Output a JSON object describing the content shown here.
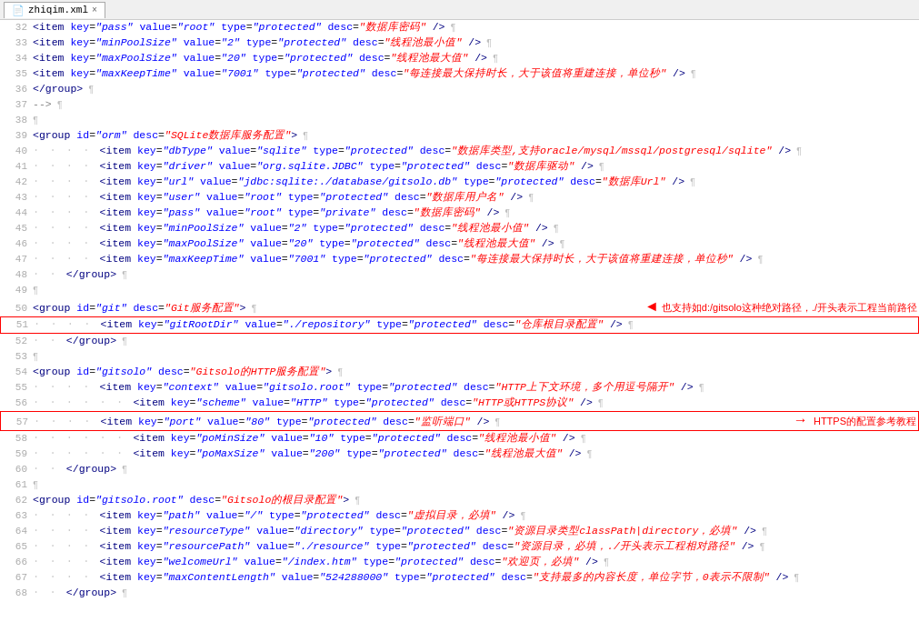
{
  "window": {
    "title": "zhiqim.xml",
    "tab_label": "zhiqim.xml",
    "close_icon": "×"
  },
  "lines": [
    {
      "num": 32,
      "content": "<item key=\"pass\" value=\"root\" type=\"protected\" desc=\"数据库密码\" />",
      "highlight": false,
      "annotation": null
    },
    {
      "num": 33,
      "content": "<item key=\"minPoolSize\" value=\"2\" type=\"protected\" desc=\"线程池最小值\" />",
      "highlight": false,
      "annotation": null
    },
    {
      "num": 34,
      "content": "<item key=\"maxPoolSize\" value=\"20\" type=\"protected\" desc=\"线程池最大值\" />",
      "highlight": false,
      "annotation": null
    },
    {
      "num": 35,
      "content": "<item key=\"maxKeepTime\" value=\"7001\" type=\"protected\" desc=\"每连接最大保持时长，大于该值将重建连接，单位秒\" />",
      "highlight": false,
      "annotation": null
    },
    {
      "num": 36,
      "content": "</group>",
      "highlight": false,
      "annotation": null
    },
    {
      "num": 37,
      "content": "-->",
      "highlight": false,
      "annotation": null,
      "is_comment": true
    },
    {
      "num": 38,
      "content": "",
      "highlight": false,
      "annotation": null
    },
    {
      "num": 39,
      "content": "<group id=\"orm\" desc=\"SQLite数据库服务配置\">",
      "highlight": false,
      "annotation": null
    },
    {
      "num": 40,
      "content": "<item key=\"dbType\" value=\"sqlite\" type=\"protected\" desc=\"数据库类型,支持oracle/mysql/mssql/postgresql/sqlite\" />",
      "highlight": false,
      "annotation": null,
      "indent": 4
    },
    {
      "num": 41,
      "content": "<item key=\"driver\" value=\"org.sqlite.JDBC\" type=\"protected\" desc=\"数据库驱动\" />",
      "highlight": false,
      "annotation": null,
      "indent": 4
    },
    {
      "num": 42,
      "content": "<item key=\"url\" value=\"jdbc:sqlite:./database/gitsolo.db\" type=\"protected\" desc=\"数据库Url\" />",
      "highlight": false,
      "annotation": null,
      "indent": 4
    },
    {
      "num": 43,
      "content": "<item key=\"user\" value=\"root\" type=\"protected\" desc=\"数据库用户名\" />",
      "highlight": false,
      "annotation": null,
      "indent": 4
    },
    {
      "num": 44,
      "content": "<item key=\"pass\" value=\"root\" type=\"private\" desc=\"数据库密码\" />",
      "highlight": false,
      "annotation": null,
      "indent": 4
    },
    {
      "num": 45,
      "content": "<item key=\"minPoolSize\" value=\"2\" type=\"protected\" desc=\"线程池最小值\" />",
      "highlight": false,
      "annotation": null,
      "indent": 4
    },
    {
      "num": 46,
      "content": "<item key=\"maxPoolSize\" value=\"20\" type=\"protected\" desc=\"线程池最大值\" />",
      "highlight": false,
      "annotation": null,
      "indent": 4
    },
    {
      "num": 47,
      "content": "<item key=\"maxKeepTime\" value=\"7001\" type=\"protected\" desc=\"每连接最大保持时长，大于该值将重建连接，单位秒\" />",
      "highlight": false,
      "annotation": null,
      "indent": 4
    },
    {
      "num": 48,
      "content": "</group>",
      "highlight": false,
      "annotation": null,
      "indent": 2
    },
    {
      "num": 49,
      "content": "",
      "highlight": false,
      "annotation": null
    },
    {
      "num": 50,
      "content": "<group id=\"git\" desc=\"Git服务配置\">",
      "highlight": false,
      "annotation": null,
      "annotation_text": "也支持如d:/gitsolo这种绝对路径，./开头表示工程当前路径",
      "annotation_side": "right"
    },
    {
      "num": 51,
      "content": "<item key=\"gitRootDir\" value=\"./repository\" type=\"protected\" desc=\"仓库根目录配置\" />",
      "highlight": true,
      "annotation": null,
      "indent": 4
    },
    {
      "num": 52,
      "content": "</group>",
      "highlight": false,
      "annotation": null,
      "indent": 2
    },
    {
      "num": 53,
      "content": "",
      "highlight": false,
      "annotation": null
    },
    {
      "num": 54,
      "content": "<group id=\"gitsolo\" desc=\"Gitsolo的HTTP服务配置\">",
      "highlight": false,
      "annotation": null
    },
    {
      "num": 55,
      "content": "<item key=\"context\" value=\"gitsolo.root\" type=\"protected\" desc=\"HTTP上下文环境，多个用逗号隔开\" />",
      "highlight": false,
      "annotation": null,
      "indent": 4
    },
    {
      "num": 56,
      "content": "<item key=\"scheme\" value=\"HTTP\" type=\"protected\" desc=\"HTTP或HTTPS协议\" />",
      "highlight": false,
      "annotation": null,
      "indent": 6
    },
    {
      "num": 57,
      "content": "<item key=\"port\" value=\"80\" type=\"protected\" desc=\"监听端口\" />",
      "highlight": true,
      "annotation": "HTTPS的配置参考教程",
      "annotation_side": "right",
      "indent": 4
    },
    {
      "num": 58,
      "content": "<item key=\"poMinSize\" value=\"10\" type=\"protected\" desc=\"线程池最小值\" />",
      "highlight": false,
      "annotation": null,
      "indent": 6
    },
    {
      "num": 59,
      "content": "<item key=\"poMaxSize\" value=\"200\" type=\"protected\" desc=\"线程池最大值\" />",
      "highlight": false,
      "annotation": null,
      "indent": 6
    },
    {
      "num": 60,
      "content": "</group>",
      "highlight": false,
      "annotation": null,
      "indent": 2
    },
    {
      "num": 61,
      "content": "",
      "highlight": false,
      "annotation": null
    },
    {
      "num": 62,
      "content": "<group id=\"gitsolo.root\" desc=\"Gitsolo的根目录配置\">",
      "highlight": false,
      "annotation": null
    },
    {
      "num": 63,
      "content": "<item key=\"path\" value=\"/\" type=\"protected\" desc=\"虚拟目录，必填\" />",
      "highlight": false,
      "annotation": null,
      "indent": 4
    },
    {
      "num": 64,
      "content": "<item key=\"resourceType\" value=\"directory\" type=\"protected\" desc=\"资源目录类型classPath|directory，必填\" />",
      "highlight": false,
      "annotation": null,
      "indent": 4
    },
    {
      "num": 65,
      "content": "<item key=\"resourcePath\" value=\"./resource\" type=\"protected\" desc=\"资源目录，必填，./开头表示工程相对路径\" />",
      "highlight": false,
      "annotation": null,
      "indent": 4
    },
    {
      "num": 66,
      "content": "<item key=\"welcomeUrl\" value=\"/index.htm\" type=\"protected\" desc=\"欢迎页，必填\" />",
      "highlight": false,
      "annotation": null,
      "indent": 4
    },
    {
      "num": 67,
      "content": "<item key=\"maxContentLength\" value=\"524288000\" type=\"protected\" desc=\"支持最多的内容长度，单位字节，0表示不限制\" />",
      "highlight": false,
      "annotation": null,
      "indent": 4
    },
    {
      "num": 68,
      "content": "</group>",
      "highlight": false,
      "annotation": null,
      "indent": 2
    }
  ]
}
